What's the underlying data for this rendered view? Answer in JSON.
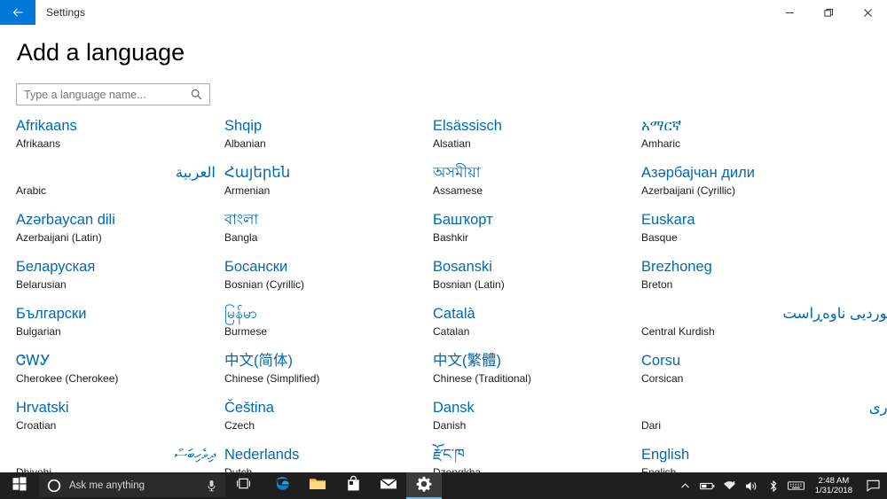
{
  "titlebar": {
    "back_icon": "back-arrow-icon",
    "title": "Settings",
    "minimize_label": "–",
    "restore_label": "❐",
    "close_label": "✕"
  },
  "page": {
    "heading": "Add a language"
  },
  "search": {
    "placeholder": "Type a language name...",
    "value": "",
    "icon": "search-icon"
  },
  "languages": [
    {
      "native": "Afrikaans",
      "english": "Afrikaans",
      "rtl": false
    },
    {
      "native": "Shqip",
      "english": "Albanian",
      "rtl": false
    },
    {
      "native": "Elsässisch",
      "english": "Alsatian",
      "rtl": false
    },
    {
      "native": "አማርኛ",
      "english": "Amharic",
      "rtl": false
    },
    {
      "native": "العربية",
      "english": "Arabic",
      "rtl": true
    },
    {
      "native": "Հայերեն",
      "english": "Armenian",
      "rtl": false
    },
    {
      "native": "অসমীয়া",
      "english": "Assamese",
      "rtl": false
    },
    {
      "native": "Азәрбајчан дили",
      "english": "Azerbaijani (Cyrillic)",
      "rtl": false
    },
    {
      "native": "Azərbaycan dili",
      "english": "Azerbaijani (Latin)",
      "rtl": false
    },
    {
      "native": "বাংলা",
      "english": "Bangla",
      "rtl": false
    },
    {
      "native": "Башҡорт",
      "english": "Bashkir",
      "rtl": false
    },
    {
      "native": "Euskara",
      "english": "Basque",
      "rtl": false
    },
    {
      "native": "Беларуская",
      "english": "Belarusian",
      "rtl": false
    },
    {
      "native": "Босански",
      "english": "Bosnian (Cyrillic)",
      "rtl": false
    },
    {
      "native": "Bosanski",
      "english": "Bosnian (Latin)",
      "rtl": false
    },
    {
      "native": "Brezhoneg",
      "english": "Breton",
      "rtl": false
    },
    {
      "native": "Български",
      "english": "Bulgarian",
      "rtl": false
    },
    {
      "native": "မြန်မာ",
      "english": "Burmese",
      "rtl": false
    },
    {
      "native": "Català",
      "english": "Catalan",
      "rtl": false
    },
    {
      "native": "کوردیی ناوەڕاست",
      "english": "Central Kurdish",
      "rtl": true
    },
    {
      "native": "ᏣᎳᎩ",
      "english": "Cherokee (Cherokee)",
      "rtl": false
    },
    {
      "native": "中文(简体)",
      "english": "Chinese (Simplified)",
      "rtl": false
    },
    {
      "native": "中文(繁體)",
      "english": "Chinese (Traditional)",
      "rtl": false
    },
    {
      "native": "Corsu",
      "english": "Corsican",
      "rtl": false
    },
    {
      "native": "Hrvatski",
      "english": "Croatian",
      "rtl": false
    },
    {
      "native": "Čeština",
      "english": "Czech",
      "rtl": false
    },
    {
      "native": "Dansk",
      "english": "Danish",
      "rtl": false
    },
    {
      "native": "دری",
      "english": "Dari",
      "rtl": true
    },
    {
      "native": "ދިވެހިބަސް",
      "english": "Dhivehi",
      "rtl": true
    },
    {
      "native": "Nederlands",
      "english": "Dutch",
      "rtl": false
    },
    {
      "native": "རྫོང་ཁ",
      "english": "Dzongkha",
      "rtl": false
    },
    {
      "native": "English",
      "english": "English",
      "rtl": false
    }
  ],
  "taskbar": {
    "start_icon": "windows-start-icon",
    "cortana": {
      "icon": "cortana-circle-icon",
      "placeholder": "Ask me anything",
      "mic_icon": "microphone-icon"
    },
    "taskview_icon": "task-view-icon",
    "apps": [
      {
        "name": "edge",
        "icon": "edge-icon",
        "active": false
      },
      {
        "name": "explorer",
        "icon": "file-explorer-icon",
        "active": false
      },
      {
        "name": "store",
        "icon": "microsoft-store-icon",
        "active": false
      },
      {
        "name": "mail",
        "icon": "mail-icon",
        "active": false
      },
      {
        "name": "settings",
        "icon": "settings-gear-icon",
        "active": true
      }
    ],
    "tray": [
      {
        "name": "show-hidden-icons",
        "icon": "chevron-up-icon"
      },
      {
        "name": "battery",
        "icon": "battery-icon"
      },
      {
        "name": "network",
        "icon": "wifi-icon"
      },
      {
        "name": "volume",
        "icon": "speaker-icon"
      },
      {
        "name": "bluetooth",
        "icon": "bluetooth-icon"
      },
      {
        "name": "touch-keyboard",
        "icon": "keyboard-icon"
      }
    ],
    "clock": {
      "time": "2:48 AM",
      "date": "1/31/2018"
    },
    "action_center_icon": "action-center-icon"
  },
  "colors": {
    "accent": "#0078d7",
    "link": "#0069b5",
    "taskbar": "#1f1f1f",
    "active_underline": "#4cc2ff"
  }
}
